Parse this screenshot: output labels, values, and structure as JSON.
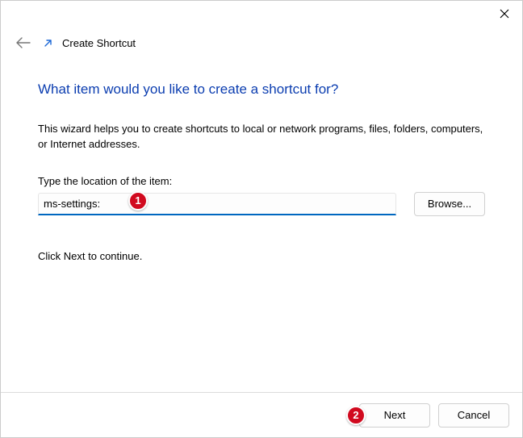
{
  "titlebar": {
    "close_aria": "Close"
  },
  "header": {
    "title": "Create Shortcut"
  },
  "main": {
    "heading": "What item would you like to create a shortcut for?",
    "description": "This wizard helps you to create shortcuts to local or network programs, files, folders, computers, or Internet addresses.",
    "location_label": "Type the location of the item:",
    "location_value": "ms-settings:",
    "browse_label": "Browse...",
    "continue_text": "Click Next to continue."
  },
  "footer": {
    "next_label": "Next",
    "cancel_label": "Cancel"
  },
  "callouts": {
    "one": "1",
    "two": "2"
  }
}
